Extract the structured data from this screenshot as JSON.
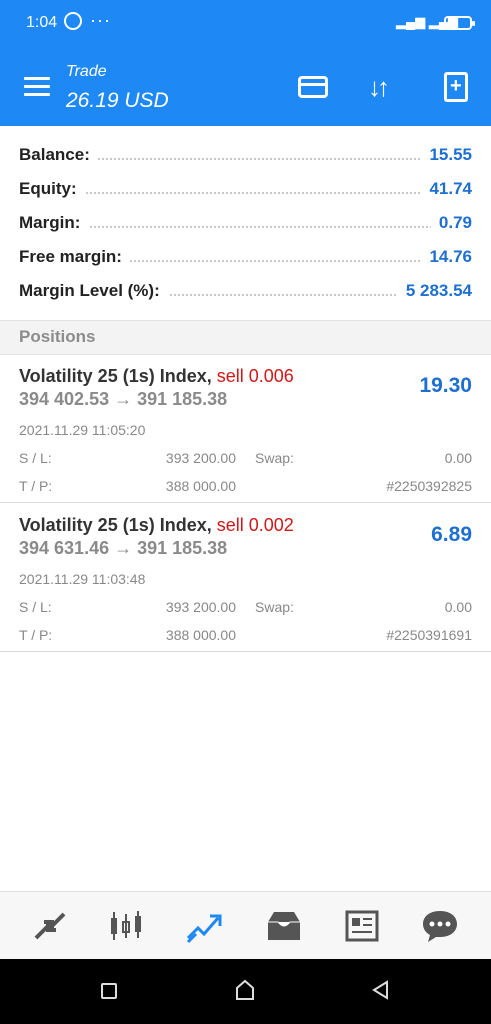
{
  "status_bar": {
    "time": "1:04",
    "dots": "···"
  },
  "app_bar": {
    "title": "Trade",
    "subtitle": "26.19 USD"
  },
  "summary": [
    {
      "label": "Balance:",
      "value": "15.55"
    },
    {
      "label": "Equity:",
      "value": "41.74"
    },
    {
      "label": "Margin:",
      "value": "0.79"
    },
    {
      "label": "Free margin:",
      "value": "14.76"
    },
    {
      "label": "Margin Level (%):",
      "value": "5 283.54"
    }
  ],
  "positions_header": "Positions",
  "positions": [
    {
      "symbol": "Volatility 25 (1s) Index,",
      "side": "sell 0.006",
      "prices": "394 402.53 → 391 185.38",
      "profit": "19.30",
      "time": "2021.11.29 11:05:20",
      "sl_label": "S / L:",
      "sl_value": "393 200.00",
      "swap_label": "Swap:",
      "swap_value": "0.00",
      "tp_label": "T / P:",
      "tp_value": "388 000.00",
      "ticket": "#2250392825"
    },
    {
      "symbol": "Volatility 25 (1s) Index,",
      "side": "sell 0.002",
      "prices": "394 631.46 → 391 185.38",
      "profit": "6.89",
      "time": "2021.11.29 11:03:48",
      "sl_label": "S / L:",
      "sl_value": "393 200.00",
      "swap_label": "Swap:",
      "swap_value": "0.00",
      "tp_label": "T / P:",
      "tp_value": "388 000.00",
      "ticket": "#2250391691"
    }
  ],
  "bottom_nav": [
    {
      "name": "quotes-icon",
      "active": false
    },
    {
      "name": "chart-icon",
      "active": false
    },
    {
      "name": "trade-icon",
      "active": true
    },
    {
      "name": "history-icon",
      "active": false
    },
    {
      "name": "news-icon",
      "active": false
    },
    {
      "name": "chat-icon",
      "active": false
    }
  ],
  "colors": {
    "accent": "#1e88f5",
    "value_blue": "#1e6fd0",
    "sell_red": "#d01818"
  }
}
